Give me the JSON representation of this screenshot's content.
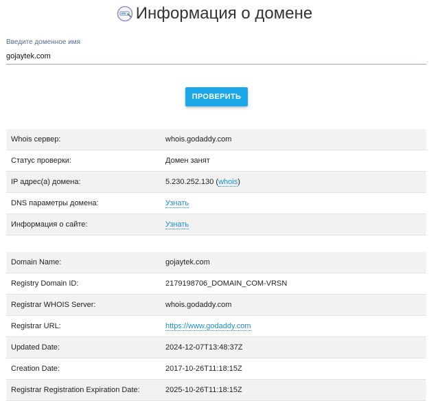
{
  "header": {
    "title": "Информация о домене",
    "logo_icon": "domain-search-icon"
  },
  "search": {
    "label": "Введите доменное имя",
    "value": "gojaytek.com"
  },
  "check_button": {
    "label": "ПРОВЕРИТЬ"
  },
  "colors": {
    "accent": "#1ba7e8",
    "link": "#1a8fd1",
    "row_alt": "#f2f2f2"
  },
  "summary": {
    "rows": [
      {
        "key": "Whois сервер:",
        "value": "whois.godaddy.com"
      },
      {
        "key": "Статус проверки:",
        "value": "Домен занят"
      },
      {
        "key": "IP адрес(а) домена:",
        "value": "5.230.252.130",
        "open": "(",
        "link": "whois",
        "close": ")"
      },
      {
        "key": "DNS параметры домена:",
        "link": "Узнать"
      },
      {
        "key": "Информация о сайте:",
        "link": "Узнать"
      }
    ]
  },
  "whois": {
    "rows": [
      {
        "key": "Domain Name:",
        "value": "gojaytek.com"
      },
      {
        "key": "Registry Domain ID:",
        "value": "2179198706_DOMAIN_COM-VRSN"
      },
      {
        "key": "Registrar WHOIS Server:",
        "value": "whois.godaddy.com"
      },
      {
        "key": "Registrar URL:",
        "link": "https://www.godaddy.com"
      },
      {
        "key": "Updated Date:",
        "value": "2024-12-07T13:48:37Z"
      },
      {
        "key": "Creation Date:",
        "value": "2017-10-26T11:18:15Z"
      },
      {
        "key": "Registrar Registration Expiration Date:",
        "value": "2025-10-26T11:18:15Z"
      }
    ]
  }
}
